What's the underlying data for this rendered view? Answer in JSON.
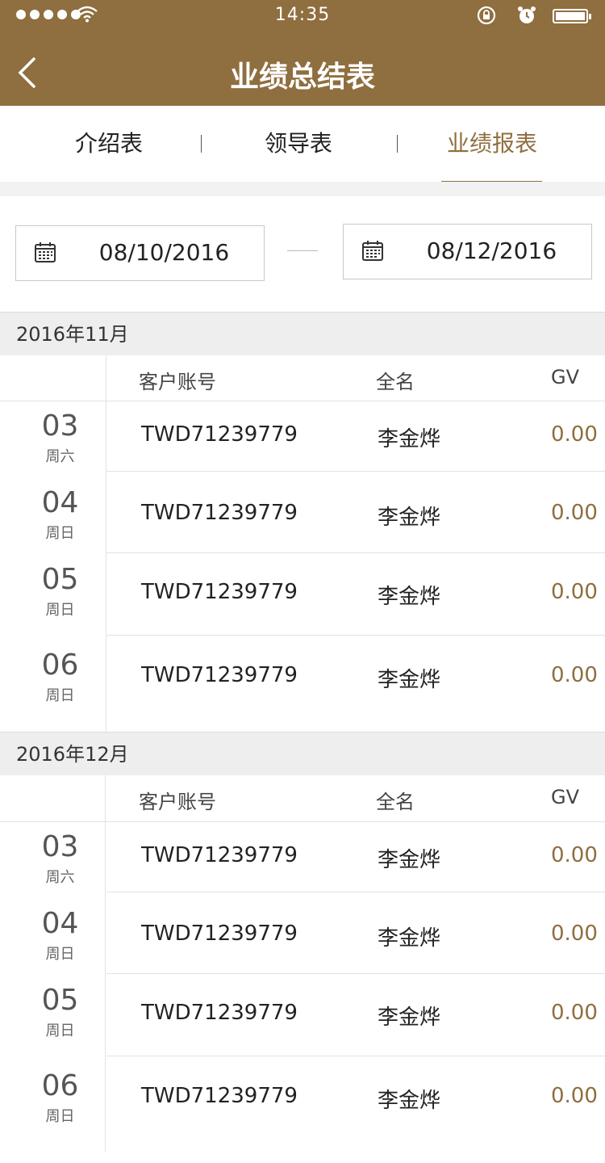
{
  "status_bar": {
    "time": "14:35"
  },
  "header": {
    "title": "业绩总结表"
  },
  "tabs": [
    {
      "label": "介绍表"
    },
    {
      "label": "领导表"
    },
    {
      "label": "业绩报表"
    }
  ],
  "date_range": {
    "start": "08/10/2016",
    "end": "08/12/2016"
  },
  "columns": {
    "account": "客户账号",
    "name": "全名",
    "gv": "GV"
  },
  "sections": [
    {
      "month": "2016年11月",
      "rows": [
        {
          "day": "03",
          "weekday": "周六",
          "account": "TWD71239779",
          "name": "李金烨",
          "gv": "0.00"
        },
        {
          "day": "04",
          "weekday": "周日",
          "account": "TWD71239779",
          "name": "李金烨",
          "gv": "0.00"
        },
        {
          "day": "05",
          "weekday": "周日",
          "account": "TWD71239779",
          "name": "李金烨",
          "gv": "0.00"
        },
        {
          "day": "06",
          "weekday": "周日",
          "account": "TWD71239779",
          "name": "李金烨",
          "gv": "0.00"
        }
      ]
    },
    {
      "month": "2016年12月",
      "rows": [
        {
          "day": "03",
          "weekday": "周六",
          "account": "TWD71239779",
          "name": "李金烨",
          "gv": "0.00"
        },
        {
          "day": "04",
          "weekday": "周日",
          "account": "TWD71239779",
          "name": "李金烨",
          "gv": "0.00"
        },
        {
          "day": "05",
          "weekday": "周日",
          "account": "TWD71239779",
          "name": "李金烨",
          "gv": "0.00"
        },
        {
          "day": "06",
          "weekday": "周日",
          "account": "TWD71239779",
          "name": "李金烨",
          "gv": "0.00"
        }
      ]
    }
  ],
  "colors": {
    "brand": "#8f6e3f",
    "gv_value": "#8f6e3f"
  }
}
